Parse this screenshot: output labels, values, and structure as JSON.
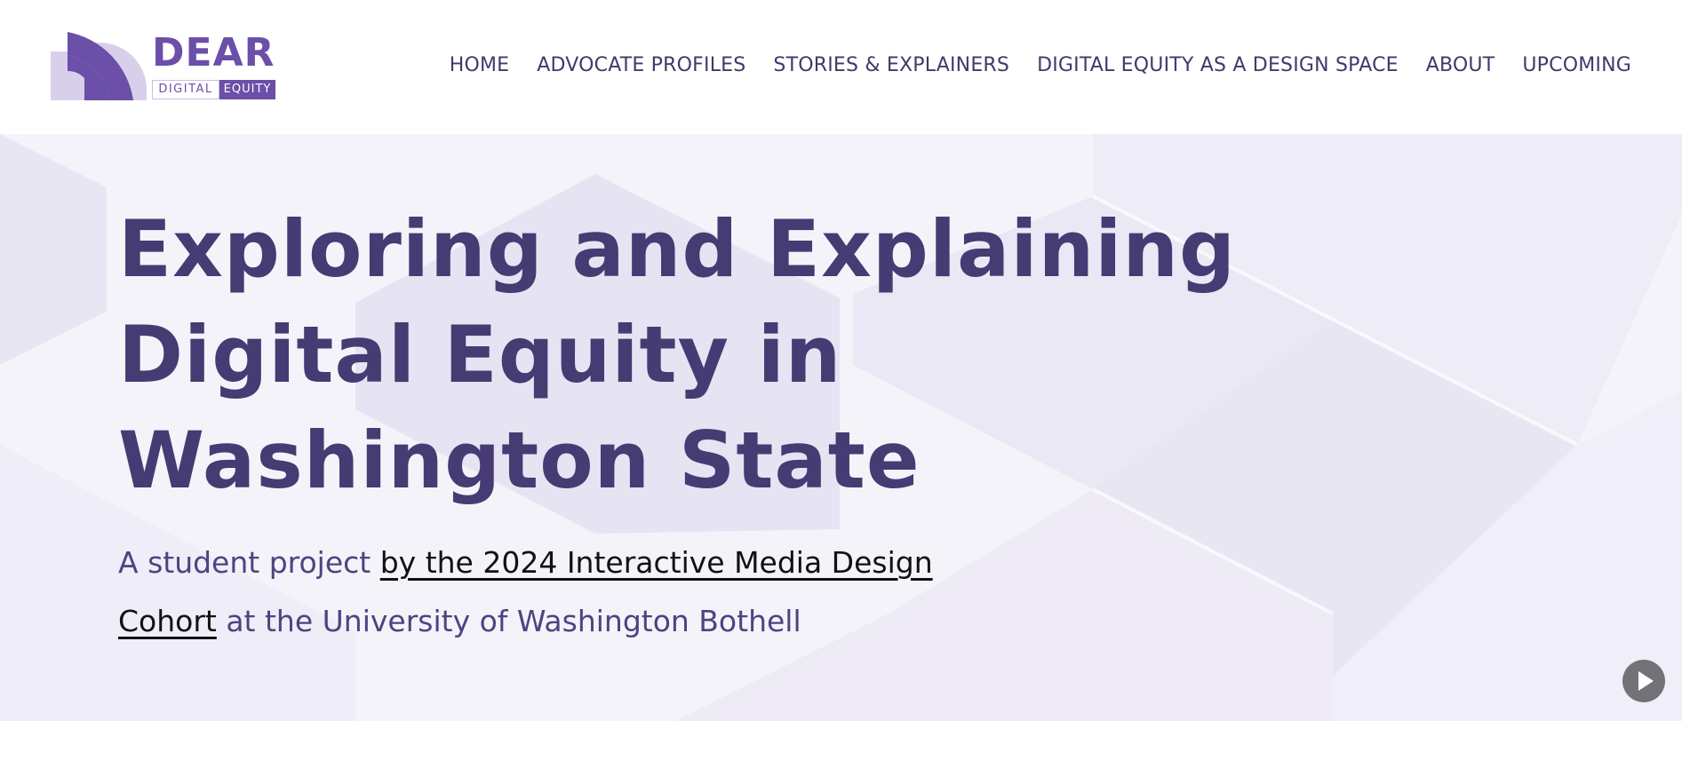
{
  "logo": {
    "word": "DEAR",
    "digital": "DIGITAL",
    "equity": "EQUITY"
  },
  "nav": {
    "items": [
      {
        "label": "HOME"
      },
      {
        "label": "ADVOCATE PROFILES"
      },
      {
        "label": "STORIES & EXPLAINERS"
      },
      {
        "label": "DIGITAL EQUITY AS A DESIGN SPACE"
      },
      {
        "label": "ABOUT"
      },
      {
        "label": "UPCOMING"
      }
    ]
  },
  "hero": {
    "title_lines": [
      "Exploring and Explaining",
      "Digital Equity in",
      "Washington State"
    ],
    "subtitle_prefix": "A student project ",
    "subtitle_link": "by the 2024 Interactive Media Design Cohort",
    "subtitle_suffix": " at the University of Washington Bothell",
    "play_icon": "play-icon"
  },
  "colors": {
    "brand_purple": "#6b4fa8",
    "title_purple": "#463b73",
    "nav_text": "#3f3a6b",
    "hero_bg": "#f4f3fa"
  }
}
